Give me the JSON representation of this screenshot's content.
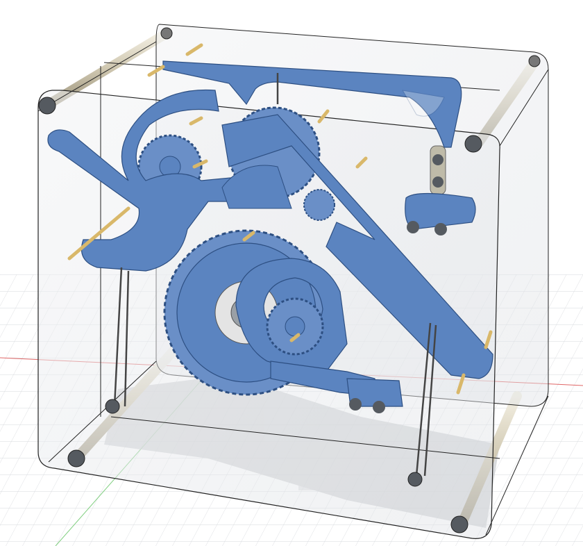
{
  "viewport": {
    "label": "",
    "background": "#ffffff"
  },
  "colors": {
    "grid": "#d3d6da",
    "x_axis": "#e06666",
    "y_axis": "#7fce7f",
    "plate": "#5b84c0",
    "plate_stroke": "#2d4f82",
    "gear": "#6a8fc7",
    "glass_stroke": "#222222",
    "glass_fill": "#e9ebee",
    "standoff": "#d8d2c0",
    "pin": "#d9b86a",
    "bolt": "#555a60",
    "shadow": "#c8cacd"
  },
  "parts": {
    "enclosure": "clear-acrylic-enclosure",
    "plates": [
      "upper-arm-plate",
      "diagonal-arm-plate",
      "lower-arm-plate",
      "crescent-arm-plate",
      "hook-plate"
    ],
    "gears": [
      "large-bottom-gear",
      "upper-left-gear",
      "upper-middle-gear",
      "small-pinion",
      "lower-right-gear"
    ],
    "fasteners": [
      "corner-standoff-bolt",
      "side-bracket-bolt",
      "front-block-bolt"
    ]
  }
}
